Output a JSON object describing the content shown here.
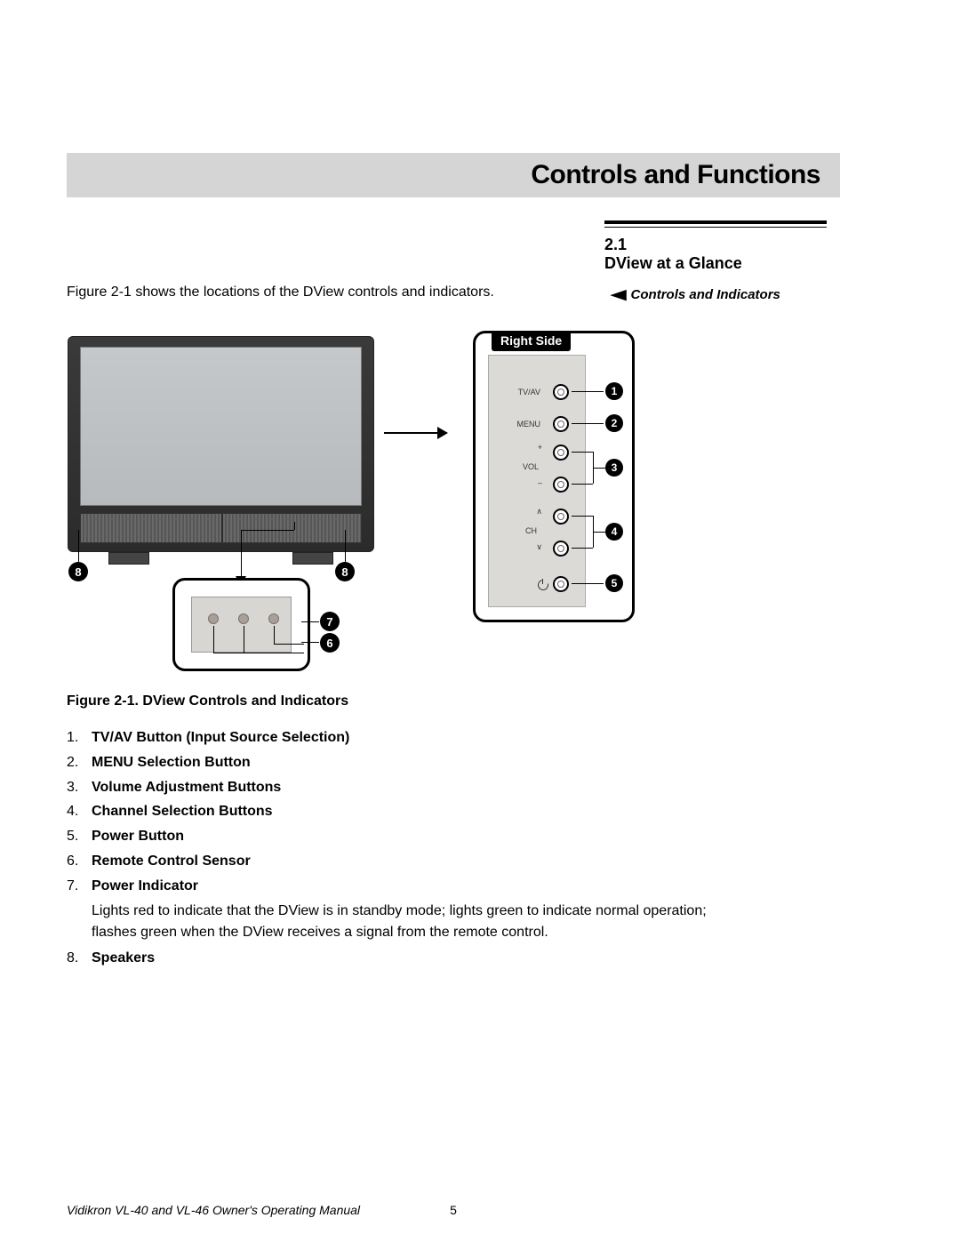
{
  "banner": {
    "title": "Controls and Functions"
  },
  "section": {
    "num": "2.1",
    "title": "DView at a Glance"
  },
  "intro": "Figure 2-1 shows the locations of the DView controls and indicators.",
  "side_subhead": "Controls and Indicators",
  "figure": {
    "right_side_label": "Right Side",
    "panel_labels": {
      "tvav": "TV/AV",
      "menu": "MENU",
      "vol": "VOL",
      "vol_plus": "+",
      "vol_minus": "–",
      "ch": "CH",
      "ch_up": "∧",
      "ch_down": "∨"
    },
    "callouts": {
      "c1": "1",
      "c2": "2",
      "c3": "3",
      "c4": "4",
      "c5": "5",
      "c6": "6",
      "c7": "7",
      "c8": "8"
    }
  },
  "figcaption": "Figure 2-1. DView Controls and Indicators",
  "list": [
    {
      "n": "1.",
      "label": "TV/AV Button (Input Source Selection)"
    },
    {
      "n": "2.",
      "label": "MENU Selection Button"
    },
    {
      "n": "3.",
      "label": "Volume Adjustment Buttons"
    },
    {
      "n": "4.",
      "label": "Channel Selection Buttons"
    },
    {
      "n": "5.",
      "label": "Power Button"
    },
    {
      "n": "6.",
      "label": "Remote Control Sensor"
    },
    {
      "n": "7.",
      "label": "Power Indicator",
      "desc": "Lights red to indicate that the DView is in standby mode; lights green to indicate normal operation; flashes green when the DView receives a signal from the remote control."
    },
    {
      "n": "8.",
      "label": "Speakers"
    }
  ],
  "footer": {
    "manual": "Vidikron VL-40 and VL-46 Owner's Operating Manual",
    "page": "5"
  }
}
